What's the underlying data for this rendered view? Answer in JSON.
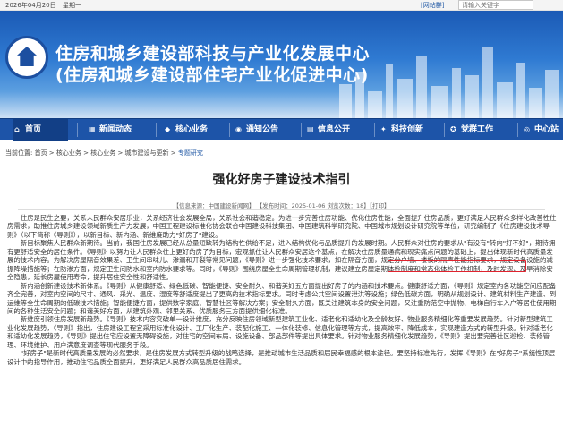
{
  "topbar": {
    "date": "2026年04月20日",
    "weekday": "星期一",
    "site_links": "[网站群]",
    "search_placeholder": "请输入关键字"
  },
  "banner": {
    "title_line1": "住房和城乡建设部科技与产业化发展中心",
    "title_line2": "(住房和城乡建设部住宅产业化促进中心)"
  },
  "nav": {
    "items": [
      {
        "label": "首页",
        "icon": "home-icon"
      },
      {
        "label": "新闻动态",
        "icon": "news-icon"
      },
      {
        "label": "核心业务",
        "icon": "core-business-icon"
      },
      {
        "label": "通知公告",
        "icon": "notice-icon"
      },
      {
        "label": "信息公开",
        "icon": "info-icon"
      },
      {
        "label": "科技创新",
        "icon": "innovation-icon"
      },
      {
        "label": "党群工作",
        "icon": "party-icon"
      },
      {
        "label": "中心站",
        "icon": "center-icon"
      }
    ]
  },
  "breadcrumb": {
    "prefix": "当前位置: 首页 > 核心业务 > 核心业务 > 城市建设与更新 > ",
    "current": "专题研究"
  },
  "article": {
    "title": "强化好房子建设技术指引",
    "meta": "【信息来源：中国建设新闻网】  【发布时间：2025-01-06  浏览次数：18】【打印】",
    "paragraphs": [
      "住房是民生之要，关系人民群众安居乐业，关系经济社会发展全局，关系社会和谐稳定。为进一步完善住房功能、优化住房性能，全面提升住房品质，更好满足人民群众多样化改善性住房需求，助推住房城乡建设领域新质生产力发展，中国工程建设标准化协会联合中国建设科技集团、中国建筑科学研究院、中国城市规划设计研究院等单位，研究编制了《住房建设技术导则》（以下简称《导则》），以新目标、新内涵、新维度助力\"好房子\"建设。",
      "新目标聚焦人民群众新期待。当前，我国住房发展已经从总量短缺转为结构性供给不足，进入结构优化与品质提升的发展时期。人民群众对住房的要求从\"有没有\"转向\"好不好\"，期待拥有更舒适安全的居住条件。《导则》以努力让人民群众住上更好的房子为目标，宏观抓住让人民群众安居这个基点，在解决住房质量通病和现实痛点问题的基础上，提出体现新时代高质量发展的技术内容。为解决房屋隔音效果差、卫生间串味儿、渗漏和开裂等常见问题，《导则》进一步强化技术要求，如在隔音方面，规定分户墙、楼板的隔声性能指标要求，规定设备设施的减振降噪措施等；在防渗方面，规定卫生间防水和室内防水要求等。同时，《导则》围绕房屋全生命周期管理机制，建议建立房屋定期体检制度和常态化体检工作机制，及时发现、及早消除安全隐患，延长房屋使用寿命，提升居住安全性和舒适性。",
      "新内涵创新建设技术新体系。《导则》从健康舒适、绿色低碳、智能便捷、安全耐久、和谐美好五方面提出好房子的内涵和技术要点。健康舒适方面，《导则》规定室内各功能空间应配备齐全完善，对室内空间的尺寸、通风、采光、温度、湿度等舒适度提出了更高的技术指标要求。同时考虑公共空间设置泄洪等设施；绿色低碳方面，明确从规划设计、建筑材料生产建造、到运维等全生命周期的低碳技术措施；智能便捷方面，提供数字家庭、智慧社区等解决方案；安全耐久方面，既关注建筑本身的安全问题，又注重防范空中抛物、电梯自行车入户等居住使用期间的各种生活安全问题；和谐美好方面，从建筑外观、邻里关系、优质服务三方面提供细化标准。",
      "新维度引领住房发展新趋势。《导则》技术内容突破单一设计维度，充分反映住房领域新型建筑工业化、适老化和适幼化及全龄友好、物业服务精细化等重要发展趋势。针对新型建筑工业化发展趋势，《导则》指出，住房建设工程宜采用标准化设计、工厂化生产、装配化施工、一体化装修、信息化管理等方式，提高效率、降低成本，实现建造方式的转型升级。针对适老化和适幼化发展趋势，《导则》提出住宅应设置无障碍设施，对住宅的空间布局、设施设备、部品部件等提出具体要求。针对物业服务精细化发展趋势，《导则》提出要完善社区巡检、装修管理、环境维护、用户满意度调查等现代服务手段。",
      "\"好房子\"是新时代高质量发展的必然要求，是住房发展方式转型升级的战略选择，是推动城市生活品质和居民幸福感的根本途径。要坚持标准先行，发挥《导则》在\"好房子\"系统性顶层设计中的指导作用，推动住宅品质全面提升，更好满足人民群众高品质居住需求。"
    ]
  },
  "colors": {
    "nav_bg": "#1d54a8",
    "nav_active": "#123f86",
    "highlight_border": "#e0232e",
    "link": "#2a5fa8"
  }
}
